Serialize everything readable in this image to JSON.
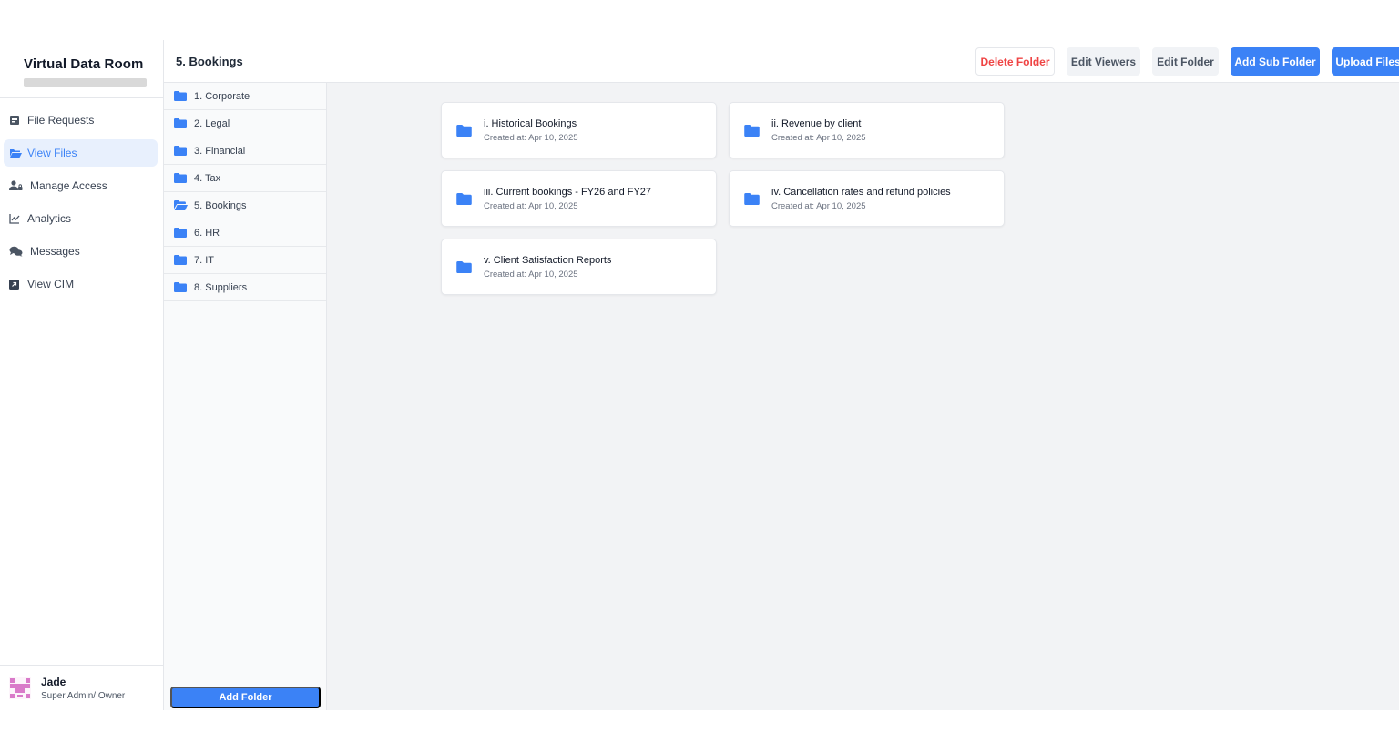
{
  "app": {
    "title": "Virtual Data Room"
  },
  "nav": {
    "items": [
      {
        "label": "File Requests",
        "icon": "file-request-icon"
      },
      {
        "label": "View Files",
        "icon": "open-folder-icon",
        "active": true
      },
      {
        "label": "Manage Access",
        "icon": "user-lock-icon"
      },
      {
        "label": "Analytics",
        "icon": "chart-line-icon"
      },
      {
        "label": "Messages",
        "icon": "chat-bubbles-icon"
      },
      {
        "label": "View CIM",
        "icon": "external-link-icon"
      }
    ]
  },
  "user": {
    "name": "Jade",
    "role": "Super Admin/ Owner"
  },
  "header": {
    "folder_title": "5. Bookings",
    "actions": {
      "delete_folder": "Delete Folder",
      "edit_viewers": "Edit Viewers",
      "edit_folder": "Edit Folder",
      "add_sub_folder": "Add Sub Folder",
      "upload_files": "Upload Files"
    }
  },
  "tree": {
    "folders": [
      {
        "label": "1. Corporate"
      },
      {
        "label": "2. Legal"
      },
      {
        "label": "3. Financial"
      },
      {
        "label": "4. Tax"
      },
      {
        "label": "5. Bookings",
        "open": true
      },
      {
        "label": "6. HR"
      },
      {
        "label": "7. IT"
      },
      {
        "label": "8. Suppliers"
      }
    ],
    "add_folder_label": "Add Folder"
  },
  "subfolders": [
    {
      "name": "i. Historical Bookings",
      "created": "Created at: Apr 10, 2025"
    },
    {
      "name": "ii. Revenue by client",
      "created": "Created at: Apr 10, 2025"
    },
    {
      "name": "iii. Current bookings - FY26 and FY27",
      "created": "Created at: Apr 10, 2025"
    },
    {
      "name": "iv. Cancellation rates and refund policies",
      "created": "Created at: Apr 10, 2025"
    },
    {
      "name": "v. Client Satisfaction Reports",
      "created": "Created at: Apr 10, 2025"
    }
  ],
  "colors": {
    "accent": "#3b82f6",
    "danger": "#ef4444",
    "active_nav_bg": "#e8f0fd"
  }
}
